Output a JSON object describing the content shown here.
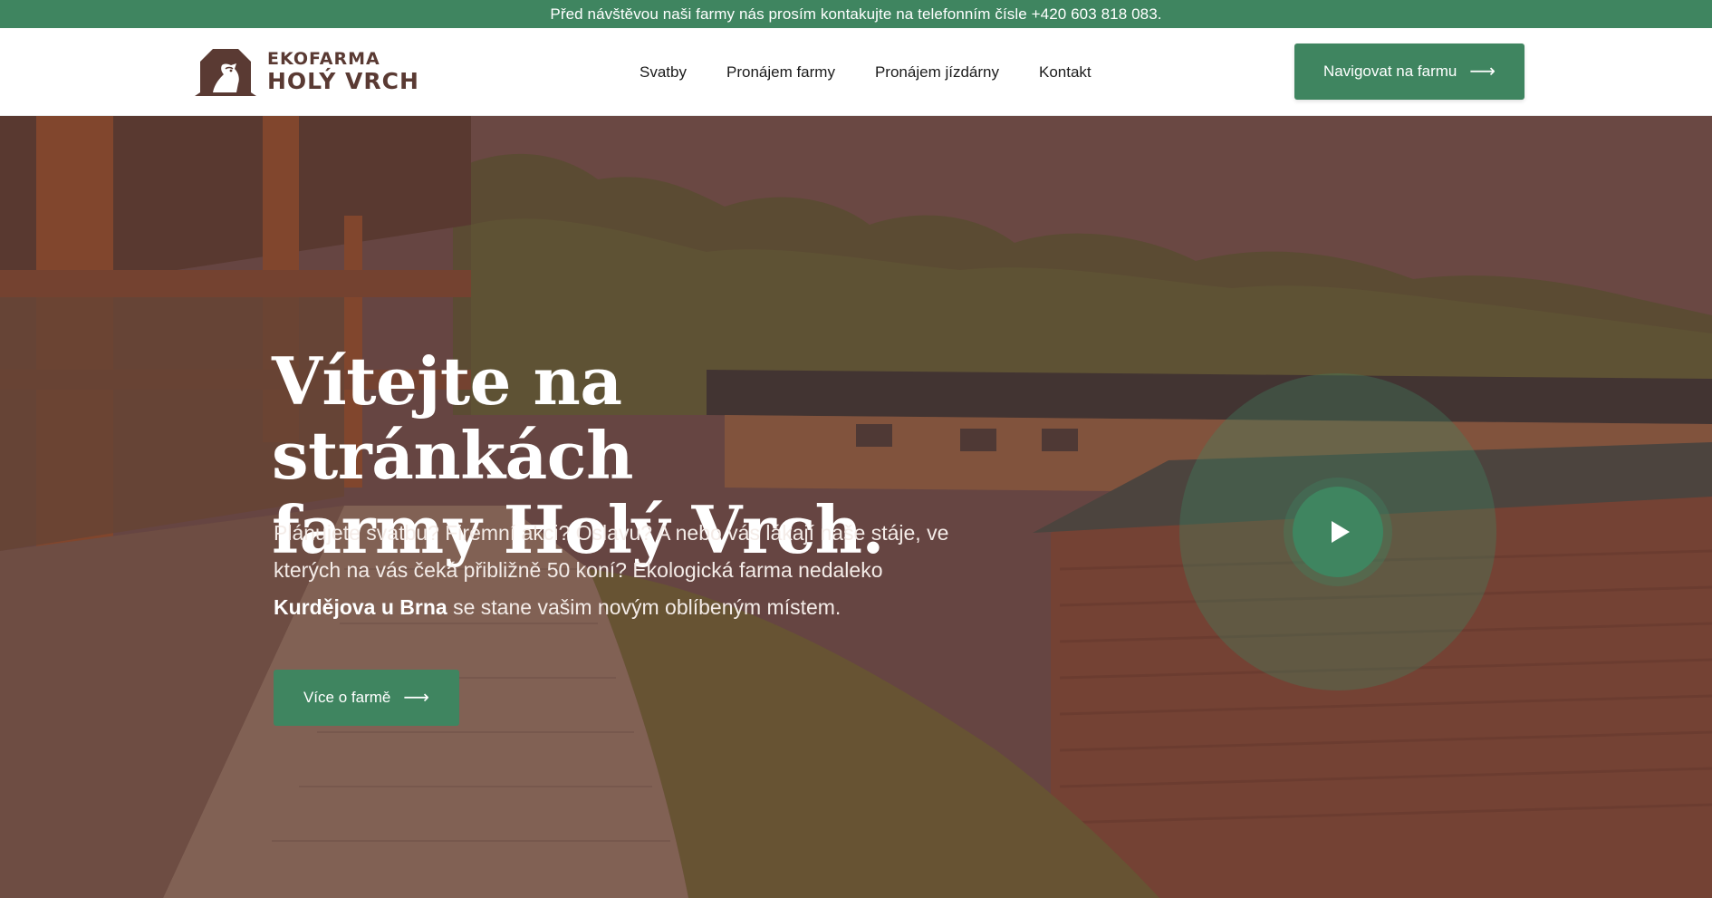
{
  "topbar": {
    "notice": "Před návštěvou naši farmy nás prosím kontakujte na telefonním čísle +420 603 818 083."
  },
  "logo": {
    "line1": "EKOFARMA",
    "line2": "HOLÝ VRCH",
    "icon": "horse-barn-icon",
    "color": "#5a3a33"
  },
  "nav": {
    "items": [
      {
        "label": "Svatby"
      },
      {
        "label": "Pronájem farmy"
      },
      {
        "label": "Pronájem jízdárny"
      },
      {
        "label": "Kontakt"
      }
    ]
  },
  "header_button": {
    "label": "Navigovat na farmu",
    "icon": "arrow-right-icon"
  },
  "hero": {
    "title_line1": "Vítejte na stránkách",
    "title_line2": "farmy Holý Vrch.",
    "text_part1": "Plánujete svatbu? Firemní akci? Oslavu? A nebo vás lákají naše stáje, ve kterých na vás čeká přibližně 50 koní? Ekologická farma nedaleko",
    "text_bold": "Kurdějova u Brna",
    "text_part2": "se stane vašim novým oblíbeným místem.",
    "button_label": "Více o farmě",
    "button_icon": "arrow-right-icon",
    "video_icon": "play-icon"
  },
  "colors": {
    "accent": "#3f8560",
    "brown": "#5a3a33",
    "hero_tint": "#6c4b49"
  }
}
